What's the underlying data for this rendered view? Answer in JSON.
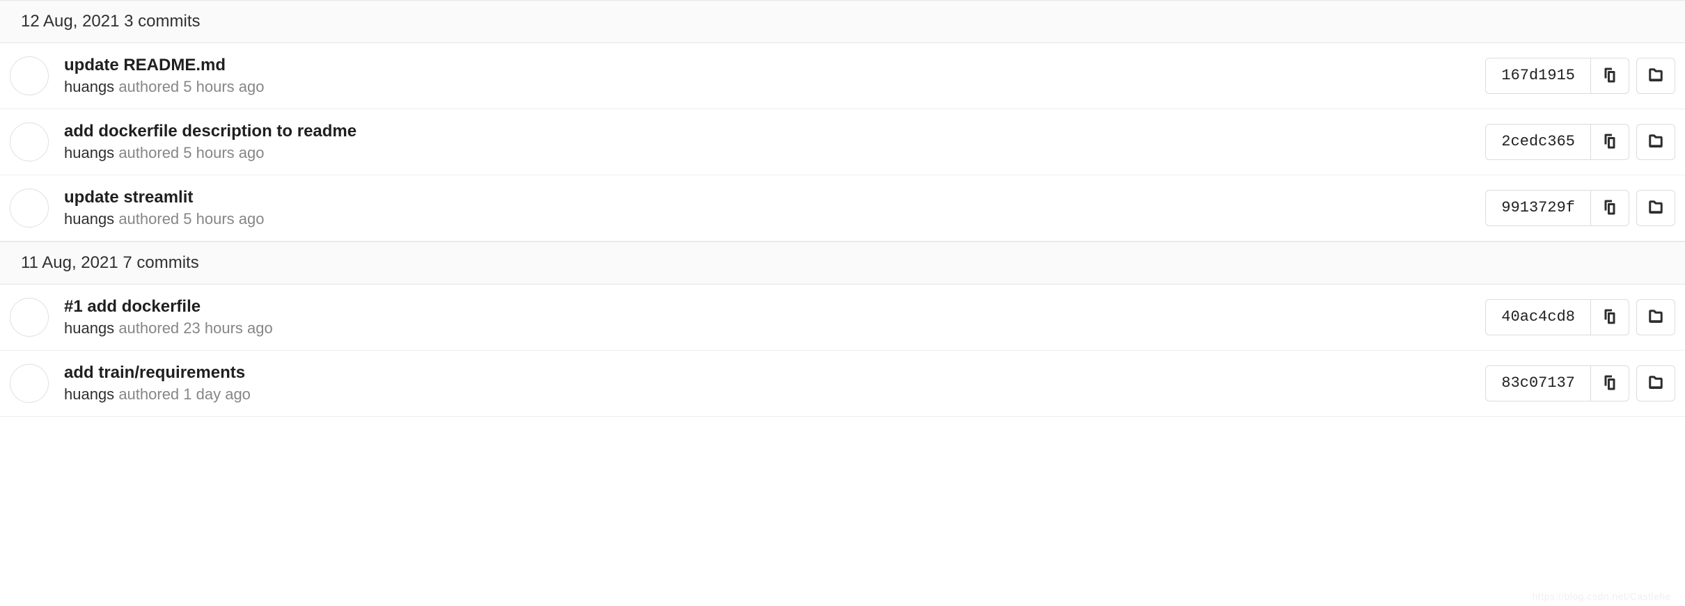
{
  "groups": [
    {
      "date": "12 Aug, 2021",
      "count_label": "3 commits",
      "commits": [
        {
          "title": "update README.md",
          "author": "huangs",
          "authored": "authored 5 hours ago",
          "sha": "167d1915"
        },
        {
          "title": "add dockerfile description to readme",
          "author": "huangs",
          "authored": "authored 5 hours ago",
          "sha": "2cedc365"
        },
        {
          "title": "update streamlit",
          "author": "huangs",
          "authored": "authored 5 hours ago",
          "sha": "9913729f"
        }
      ]
    },
    {
      "date": "11 Aug, 2021",
      "count_label": "7 commits",
      "commits": [
        {
          "title": "#1 add dockerfile",
          "author": "huangs",
          "authored": "authored 23 hours ago",
          "sha": "40ac4cd8"
        },
        {
          "title": "add train/requirements",
          "author": "huangs",
          "authored": "authored 1 day ago",
          "sha": "83c07137"
        }
      ]
    }
  ],
  "watermark": "https://blog.csdn.net/Castlehe"
}
